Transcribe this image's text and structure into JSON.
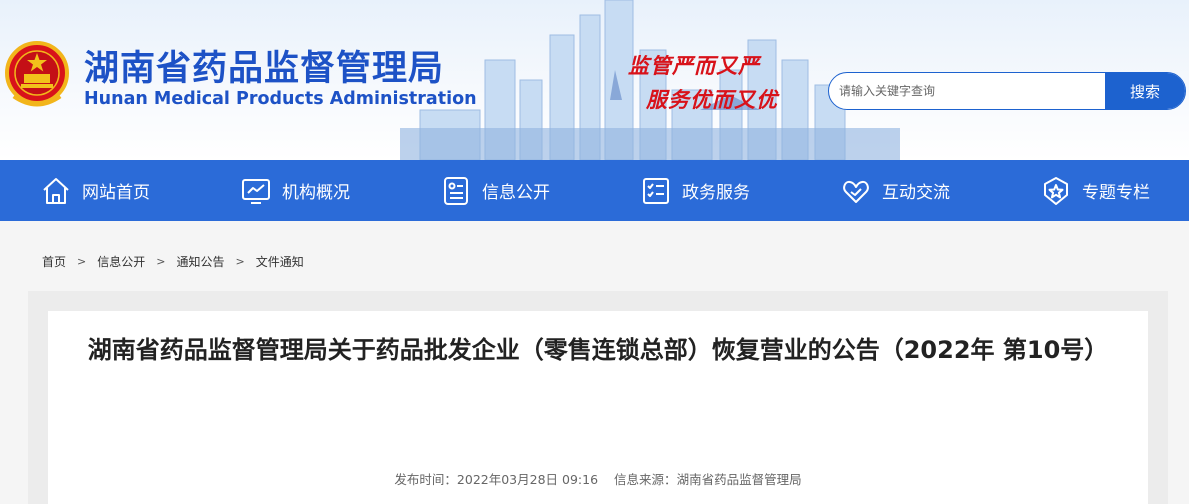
{
  "header": {
    "site_title": "湖南省药品监督管理局",
    "site_subtitle": "Hunan Medical Products Administration",
    "slogan_line1": "监管严而又严",
    "slogan_line2": "服务优而又优",
    "logo_icon": "national-emblem-icon",
    "colors": {
      "brand_blue": "#1d52c6",
      "slogan_red": "#d8121a"
    }
  },
  "search": {
    "placeholder": "请输入关键字查询",
    "value": "",
    "button_label": "搜索"
  },
  "nav": {
    "background": "#2b6bd8",
    "items": [
      {
        "label": "网站首页",
        "icon": "home-icon"
      },
      {
        "label": "机构概况",
        "icon": "chart-monitor-icon"
      },
      {
        "label": "信息公开",
        "icon": "info-card-icon"
      },
      {
        "label": "政务服务",
        "icon": "checklist-icon"
      },
      {
        "label": "互动交流",
        "icon": "heart-hands-icon"
      },
      {
        "label": "专题专栏",
        "icon": "star-badge-icon"
      }
    ]
  },
  "breadcrumb": {
    "items": [
      "首页",
      "信息公开",
      "通知公告",
      "文件通知"
    ],
    "separator": ">"
  },
  "article": {
    "title": "湖南省药品监督管理局关于药品批发企业（零售连锁总部）恢复营业的公告（2022年 第10号）",
    "publish_label": "发布时间：",
    "publish_time": "2022年03月28日 09:16",
    "source_label": "信息来源：",
    "source": "湖南省药品监督管理局"
  }
}
